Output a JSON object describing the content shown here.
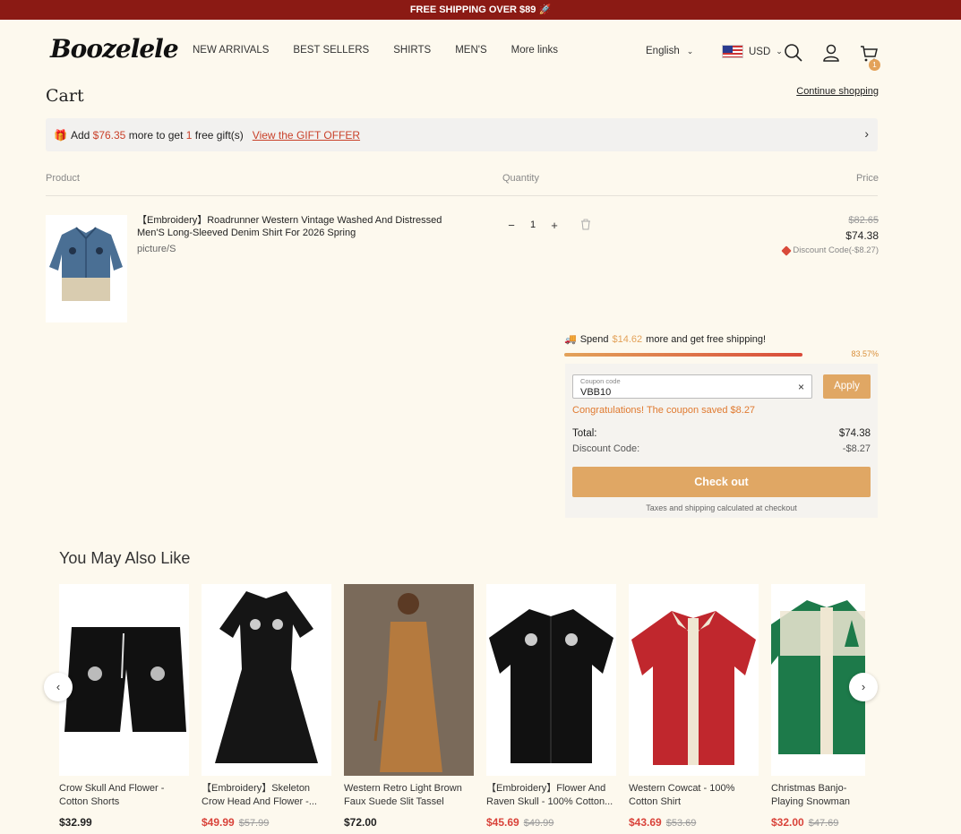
{
  "promo_bar": "FREE SHIPPING OVER $89 🚀",
  "header": {
    "logo": "Boozelele",
    "nav": [
      "NEW ARRIVALS",
      "BEST SELLERS",
      "SHIRTS",
      "MEN'S",
      "More links"
    ],
    "language": "English",
    "currency": "USD",
    "cart_count": "1"
  },
  "cart": {
    "title": "Cart",
    "continue_label": "Continue shopping",
    "gift_bar": {
      "prefix": "Add",
      "amount": "$76.35",
      "middle": "more to get",
      "count": "1",
      "suffix": "free gift(s)",
      "link": "View the GIFT OFFER"
    },
    "columns": {
      "product": "Product",
      "quantity": "Quantity",
      "price": "Price"
    },
    "item": {
      "name": "【Embroidery】Roadrunner Western Vintage Washed And Distressed Men'S Long-Sleeved Denim Shirt For 2026 Spring",
      "variant": "picture/S",
      "quantity": "1",
      "original_price": "$82.65",
      "price": "$74.38",
      "discount_label": "Discount Code(-$8.27)"
    },
    "shipping": {
      "prefix": "Spend",
      "amount": "$14.62",
      "suffix": "more and get free shipping!",
      "progress_pct": "83.57%",
      "progress_fraction": 0.8357
    },
    "summary": {
      "coupon_label": "Coupon code",
      "coupon_value": "VBB10",
      "apply_label": "Apply",
      "congrats": "Congratulations!  The coupon saved $8.27",
      "total_label": "Total:",
      "total_value": "$74.38",
      "discount_label": "Discount Code:",
      "discount_value": "-$8.27",
      "checkout_label": "Check out",
      "tax_note": "Taxes and shipping calculated at checkout"
    }
  },
  "recommendations": {
    "title": "You May Also Like",
    "items": [
      {
        "name": "Crow Skull And Flower - Cotton Shorts",
        "price": "$32.99",
        "original": ""
      },
      {
        "name": "【Embroidery】Skeleton Crow Head And Flower -...",
        "price": "$49.99",
        "original": "$57.99"
      },
      {
        "name": "Western Retro Light Brown Faux Suede Slit Tassel Shor...",
        "price": "$72.00",
        "original": ""
      },
      {
        "name": "【Embroidery】Flower And Raven Skull - 100% Cotton...",
        "price": "$45.69",
        "original": "$49.99"
      },
      {
        "name": "Western Cowcat - 100% Cotton Shirt",
        "price": "$43.69",
        "original": "$53.69"
      },
      {
        "name": "Christmas Banjo-Playing Snowman And Christmas",
        "price": "$32.00",
        "original": "$47.69"
      }
    ]
  },
  "colors": {
    "brand_red": "#8b1a14",
    "accent": "#e0a764",
    "sale_red": "#d9433a",
    "background": "#fdf9ee"
  }
}
